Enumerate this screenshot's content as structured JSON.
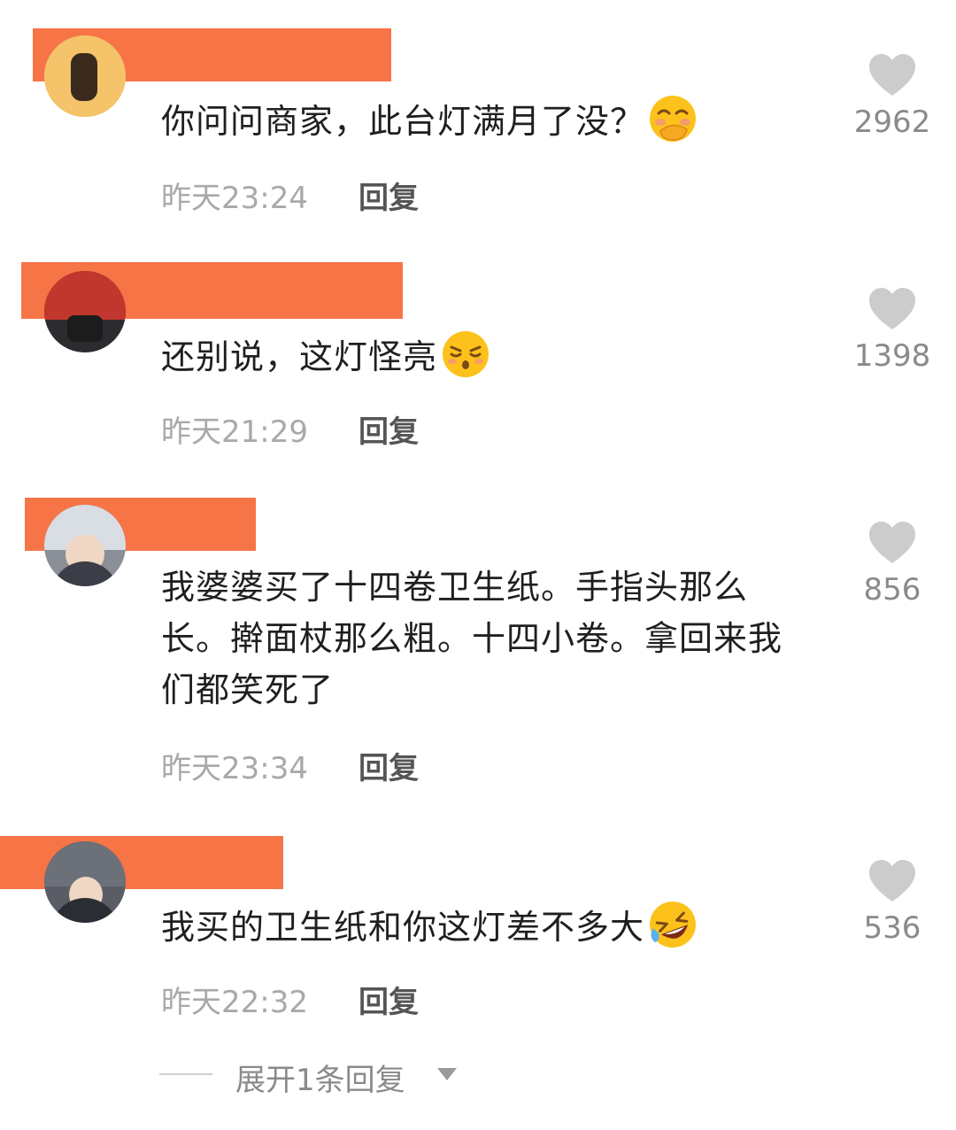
{
  "colors": {
    "name_redaction": "#f77447",
    "heart": "#cccccc",
    "time": "#a9a9a9",
    "count": "#8a8a8a"
  },
  "comments": [
    {
      "text": "你问问商家，此台灯满月了没？",
      "emoji": "smiling-face-with-hand-over-mouth",
      "time": "昨天23:24",
      "reply_label": "回复",
      "likes": "2962"
    },
    {
      "text": "还别说，这灯怪亮",
      "emoji": "kissing-face-with-closed-eyes",
      "time": "昨天21:29",
      "reply_label": "回复",
      "likes": "1398"
    },
    {
      "text": "我婆婆买了十四卷卫生纸。手指头那么长。擀面杖那么粗。十四小卷。拿回来我们都笑死了",
      "emoji": "",
      "time": "昨天23:34",
      "reply_label": "回复",
      "likes": "856"
    },
    {
      "text": "我买的卫生纸和你这灯差不多大",
      "emoji": "rolling-on-the-floor-laughing",
      "time": "昨天22:32",
      "reply_label": "回复",
      "likes": "536"
    }
  ],
  "expand_replies": {
    "label": "展开1条回复",
    "icon": "triangle-down-icon"
  }
}
